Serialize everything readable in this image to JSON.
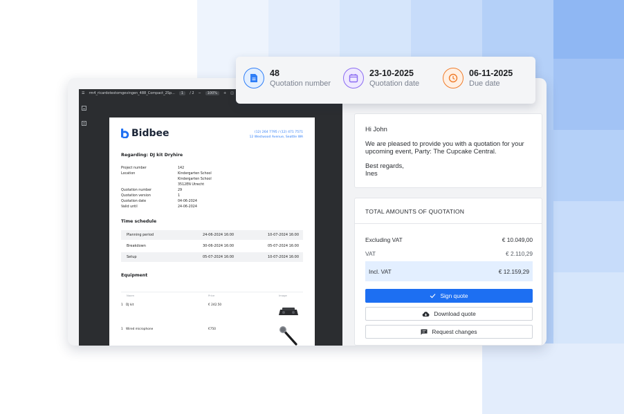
{
  "summary": {
    "items": [
      {
        "value": "48",
        "label": "Quotation number",
        "icon": "document-icon",
        "color": "#2f7ef7",
        "fill": "#e3efff"
      },
      {
        "value": "23-10-2025",
        "label": "Quotation date",
        "icon": "calendar-icon",
        "color": "#8b6bf2",
        "fill": "#efe9ff"
      },
      {
        "value": "06-11-2025",
        "label": "Due date",
        "icon": "clock-icon",
        "color": "#f07c2a",
        "fill": "#fff0e4"
      }
    ]
  },
  "pdf_viewer": {
    "filename": "rm4_ricardotestomgevingen_488_Compact_2Sp...",
    "page_current": "1",
    "page_total": "/ 2",
    "zoom": "100%",
    "minus": "−",
    "plus": "+"
  },
  "document": {
    "brand": "Bidbee",
    "contact_phone": "(12) 264 7795 / (12) 471 7571",
    "contact_address": "12 Westwood Avenue, Seattle WA",
    "regarding": "Regarding: DJ kit Dryhire",
    "details": [
      {
        "label": "Project number",
        "value": "142"
      },
      {
        "label": "Location",
        "value": "Kindergarten School"
      },
      {
        "label": "",
        "value": "Kindergarten School"
      },
      {
        "label": "",
        "value": "3512EN Utrecht"
      },
      {
        "label": "Quotation number",
        "value": "29"
      },
      {
        "label": "Quotation version",
        "value": "1"
      },
      {
        "label": "Quotation date",
        "value": "04-06-2024"
      },
      {
        "label": "Valid until",
        "value": "24-06-2024"
      }
    ],
    "time_schedule_title": "Time schedule",
    "time_schedule": [
      {
        "name": "Planning period",
        "start": "24-06-2024 16:00",
        "end": "10-07-2024 16:00"
      },
      {
        "name": "Breakdown",
        "start": "30-06-2024 16:00",
        "end": "05-07-2024 16:00"
      },
      {
        "name": "Setup",
        "start": "05-07-2024 16:00",
        "end": "10-07-2024 16:00"
      }
    ],
    "equipment_title": "Equipment",
    "equipment_headers": {
      "name": "Naam",
      "price": "Price",
      "image": "Image"
    },
    "equipment": [
      {
        "qty": "1",
        "name": "DJ kit",
        "price": "€ 242.50"
      },
      {
        "qty": "1",
        "name": "Wired microphone",
        "price": "€750"
      }
    ]
  },
  "message": {
    "greeting": "Hi John",
    "body": "We are pleased to provide you with a quotation for your upcoming event, Party: The Cupcake Central.",
    "closing": "Best regards,",
    "signature": "Ines"
  },
  "totals": {
    "title": "TOTAL AMOUNTS OF QUOTATION",
    "excl_label": "Excluding VAT",
    "excl_value": "€ 10.049,00",
    "vat_label": "VAT",
    "vat_value": "€ 2.110,29",
    "incl_label": "Incl. VAT",
    "incl_value": "€ 12.159,29"
  },
  "actions": {
    "sign": "Sign quote",
    "download": "Download quote",
    "request": "Request changes"
  },
  "colors": {
    "accent": "#1d6ff2",
    "highlight": "#e3efff"
  }
}
